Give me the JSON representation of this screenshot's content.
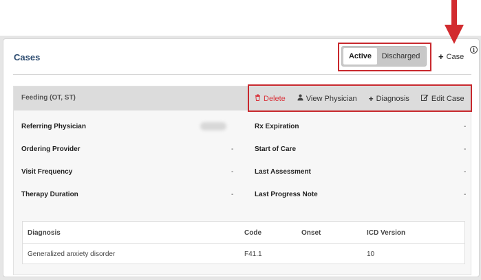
{
  "page": {
    "title": "Cases"
  },
  "toolbar": {
    "tabs": [
      {
        "label": "Active",
        "selected": true
      },
      {
        "label": "Discharged",
        "selected": false
      }
    ],
    "add_case_label": "Case",
    "info_glyph": "i"
  },
  "case": {
    "name": "Feeding (OT, ST)",
    "actions": {
      "delete": "Delete",
      "view_physician": "View Physician",
      "diagnosis": "Diagnosis",
      "edit_case": "Edit Case"
    },
    "fields_left": [
      {
        "label": "Referring Physician",
        "value": ""
      },
      {
        "label": "Ordering Provider",
        "value": "-"
      },
      {
        "label": "Visit Frequency",
        "value": "-"
      },
      {
        "label": "Therapy Duration",
        "value": "-"
      }
    ],
    "fields_right": [
      {
        "label": "Rx Expiration",
        "value": "-"
      },
      {
        "label": "Start of Care",
        "value": "-"
      },
      {
        "label": "Last Assessment",
        "value": "-"
      },
      {
        "label": "Last Progress Note",
        "value": "-"
      }
    ],
    "diagnosis_table": {
      "columns": [
        "Diagnosis",
        "Code",
        "Onset",
        "ICD Version"
      ],
      "rows": [
        [
          "Generalized anxiety disorder",
          "F41.1",
          "",
          "10"
        ]
      ]
    }
  },
  "colors": {
    "title": "#2b4a6f",
    "highlight": "#c8282d",
    "delete": "#d9363e"
  },
  "icons": {
    "arrow": "down-arrow-icon",
    "add": "plus-icon",
    "info": "info-icon",
    "delete": "trash-icon",
    "view_physician": "user-icon",
    "diagnosis": "plus-icon",
    "edit_case": "edit-icon"
  }
}
